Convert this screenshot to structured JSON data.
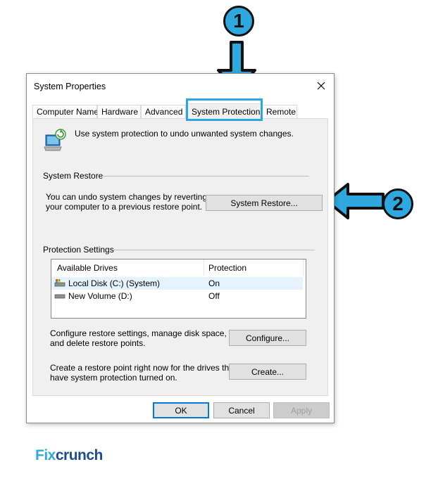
{
  "window": {
    "title": "System Properties"
  },
  "tabs": [
    {
      "label": "Computer Name"
    },
    {
      "label": "Hardware"
    },
    {
      "label": "Advanced"
    },
    {
      "label": "System Protection",
      "active": true
    },
    {
      "label": "Remote"
    }
  ],
  "intro": {
    "text": "Use system protection to undo unwanted system changes."
  },
  "system_restore": {
    "group_label": "System Restore",
    "description_line1": "You can undo system changes by reverting",
    "description_line2": "your computer to a previous restore point.",
    "button_label": "System Restore..."
  },
  "protection_settings": {
    "group_label": "Protection Settings",
    "columns": [
      "Available Drives",
      "Protection"
    ],
    "drives": [
      {
        "name": "Local Disk (C:) (System)",
        "protection": "On",
        "selected": true
      },
      {
        "name": "New Volume (D:)",
        "protection": "Off",
        "selected": false
      }
    ],
    "configure_text_line1": "Configure restore settings, manage disk space,",
    "configure_text_line2": "and delete restore points.",
    "configure_button": "Configure...",
    "create_text_line1": "Create a restore point right now for the drives that",
    "create_text_line2": "have system protection turned on.",
    "create_button": "Create..."
  },
  "footer": {
    "ok": "OK",
    "cancel": "Cancel",
    "apply": "Apply"
  },
  "annotations": {
    "step1": "1",
    "step2": "2"
  },
  "logo": {
    "part1": "Fix",
    "part2": "crunch"
  },
  "colors": {
    "accent": "#29a8e0",
    "logo_blue": "#2ea8df",
    "logo_dark": "#1d4e89"
  }
}
